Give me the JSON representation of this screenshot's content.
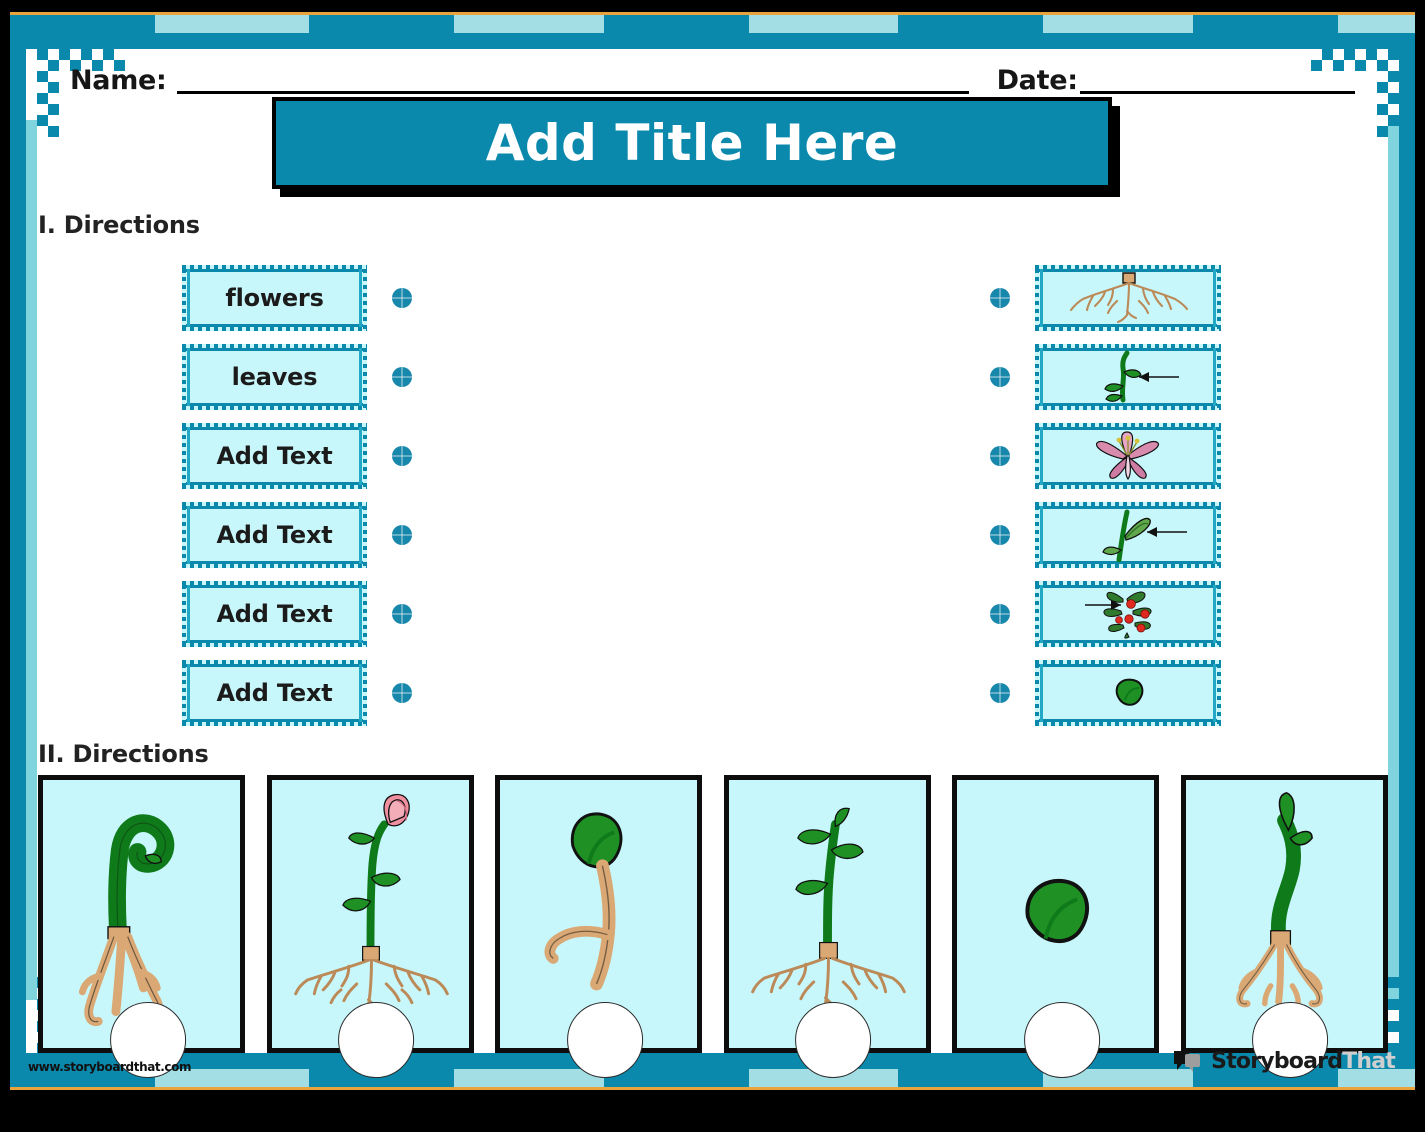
{
  "document": {
    "type": "worksheet",
    "header": {
      "name_label": "Name:",
      "date_label": "Date:"
    },
    "title": "Add Title Here",
    "sections": [
      {
        "id": "section-1",
        "heading": "I. Directions"
      },
      {
        "id": "section-2",
        "heading": "II. Directions"
      }
    ]
  },
  "matching": {
    "left_column": [
      {
        "label": "flowers"
      },
      {
        "label": "leaves"
      },
      {
        "label": "Add Text"
      },
      {
        "label": "Add Text"
      },
      {
        "label": "Add Text"
      },
      {
        "label": "Add Text"
      }
    ],
    "right_column": [
      {
        "icon": "plant-roots-icon",
        "alt": "roots"
      },
      {
        "icon": "plant-stem-arrow-icon",
        "alt": "stem with pointer arrow"
      },
      {
        "icon": "pink-lily-flower-icon",
        "alt": "pink lily flower"
      },
      {
        "icon": "plant-leaf-arrow-icon",
        "alt": "leaf with pointer arrow"
      },
      {
        "icon": "berries-branch-arrow-icon",
        "alt": "berries on branch with pointer arrow"
      },
      {
        "icon": "green-seed-icon",
        "alt": "green seed"
      }
    ]
  },
  "sequence_panels": [
    {
      "icon": "sprout-hook-roots-icon",
      "alt": "hooked green sprout with roots"
    },
    {
      "icon": "rose-plant-roots-icon",
      "alt": "rose flower plant with roots"
    },
    {
      "icon": "germinating-seed-icon",
      "alt": "germinating seed with root"
    },
    {
      "icon": "leafy-seedling-roots-icon",
      "alt": "leafy seedling with roots"
    },
    {
      "icon": "seed-icon",
      "alt": "green seed"
    },
    {
      "icon": "young-shoot-roots-icon",
      "alt": "young shoot with roots"
    }
  ],
  "footer": {
    "url": "www.storyboardthat.com",
    "logo_primary": "Storyboard",
    "logo_secondary": "That"
  },
  "colors": {
    "teal": "#0a89ad",
    "light_teal": "#a3dee4",
    "card_fill": "#c8f7fb",
    "orange_rule": "#e8a33d",
    "ink": "#161616",
    "page_bg": "#000000"
  }
}
